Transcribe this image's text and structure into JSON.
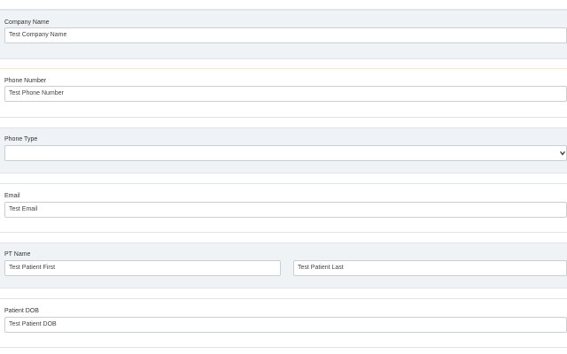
{
  "company": {
    "label": "Company Name",
    "value": "Test Company Name"
  },
  "phone": {
    "label": "Phone Number",
    "value": "Test Phone Number"
  },
  "phone_type": {
    "label": "Phone Type",
    "value": ""
  },
  "email": {
    "label": "Email",
    "value": "Test Email"
  },
  "pt_name": {
    "label": "PT Name",
    "first": "Test Patient First",
    "last": "Test Patient Last"
  },
  "dob": {
    "label": "Patient DOB",
    "value": "Test Patient DOB"
  },
  "icons": {
    "select_arrow": "chevron-down-icon",
    "required_marker": "red-corner-flag-icon"
  },
  "colors": {
    "section_bg": "#f0f3f6",
    "border": "#c9cfd6",
    "marker": "#d93a3a"
  }
}
